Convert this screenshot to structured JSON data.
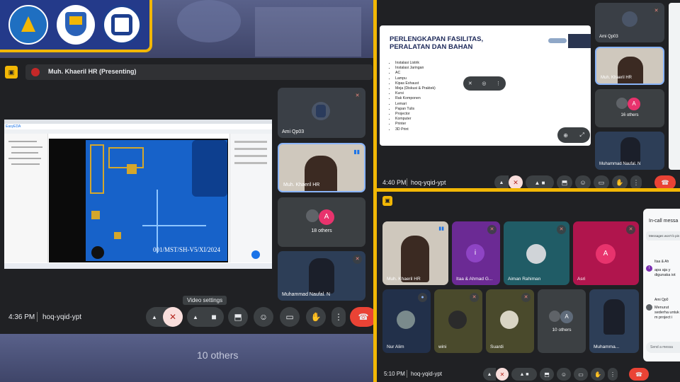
{
  "panel1": {
    "banner": {
      "logo1": "TUT WURI HANDAYANI",
      "logo2": "",
      "logo3": "POLITEKNIK NEGERI BALI"
    },
    "presenting_label": "Muh. Khaeril HR (Presenting)",
    "bg_text": "10 others",
    "slide": {
      "app_name": "EasyEDA",
      "watermark": "001/MST/SH-V5/XI/2024"
    },
    "tiles": [
      {
        "name": "Ami Qp03"
      },
      {
        "name": "Muh. Khaeril HR"
      },
      {
        "name": "18 others",
        "avatar": "A"
      },
      {
        "name": "Muhammad Naufal. N"
      }
    ],
    "tooltip": "Video settings",
    "time": "4:36 PM",
    "meeting_code": "hoq-yqid-ypt"
  },
  "panel2": {
    "slide_title": "PERLENGKAPAN FASILITAS, PERALATAN DAN BAHAN",
    "slide_items": [
      "Instalasi Listrik",
      "Instalasi Jaringan",
      "AC",
      "Lampu",
      "Kipas Exhaust",
      "Meja (Diskusi & Praktek)",
      "Kursi",
      "Rak Komponen",
      "Lemari",
      "Papan Tulis",
      "Projector",
      "Komputer",
      "Printer",
      "3D Print"
    ],
    "tiles": [
      {
        "name": "Ami Qp03"
      },
      {
        "name": "Muh. Khaeril HR"
      },
      {
        "name": "16 others",
        "avatar": "A"
      },
      {
        "name": "Muhammad Naufal. N"
      }
    ],
    "time": "4:40 PM",
    "meeting_code": "hoq-yqid-ypt"
  },
  "panel3": {
    "tiles": [
      {
        "name": "Muh. Khaeril HR"
      },
      {
        "name": "Itaa & Ahmad G...",
        "avatar": "i"
      },
      {
        "name": "Aiman Rahiman"
      },
      {
        "name": "Asri",
        "avatar": "A"
      },
      {
        "name": "Nur Alim"
      },
      {
        "name": "wini"
      },
      {
        "name": "Suardi"
      },
      {
        "name": "10 others",
        "avatar": "A"
      },
      {
        "name": "Muhamma..."
      }
    ],
    "chat": {
      "title": "In-call messa",
      "notice": "Messages won't b pin a message fo",
      "messages": [
        {
          "sender": "Itaa & Ah",
          "avatar": "I",
          "text": "apa aja y digunaka iot"
        },
        {
          "sender": "Ami Qp0",
          "text": "Menurut sederha untuk m project i"
        }
      ],
      "input_placeholder": "Send a messa"
    },
    "time": "5:10 PM",
    "meeting_code": "hoq-yqid-ypt"
  },
  "colors": {
    "accent_yellow": "#f2b705",
    "end_call": "#ea4335",
    "avatar_pink": "#e8336d",
    "avatar_purple": "#7b2fb0"
  }
}
